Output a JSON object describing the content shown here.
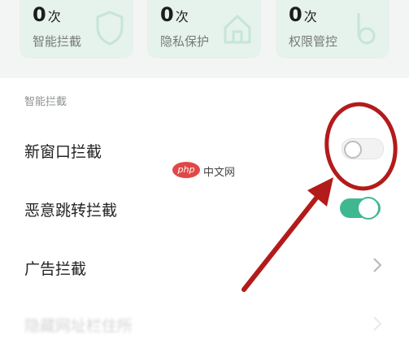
{
  "stats": [
    {
      "value": "0",
      "unit": "次",
      "label": "智能拦截",
      "icon": "shield-icon"
    },
    {
      "value": "0",
      "unit": "次",
      "label": "隐私保护",
      "icon": "house-icon"
    },
    {
      "value": "0",
      "unit": "次",
      "label": "权限管控",
      "icon": "key-icon"
    }
  ],
  "section": {
    "title": "智能拦截"
  },
  "rows": [
    {
      "label": "新窗口拦截",
      "control": "toggle",
      "enabled": false
    },
    {
      "label": "恶意跳转拦截",
      "control": "toggle",
      "enabled": true
    },
    {
      "label": "广告拦截",
      "control": "chevron"
    },
    {
      "label": "隐藏网址栏住所",
      "control": "chevron",
      "blurred": true
    }
  ],
  "watermark": {
    "logo": "php",
    "text": "中文网"
  },
  "colors": {
    "accent": "#3fb892",
    "annotation": "#b31b1b",
    "card_bg": "#e6f2ec",
    "page_bg": "#f3f5f4"
  }
}
